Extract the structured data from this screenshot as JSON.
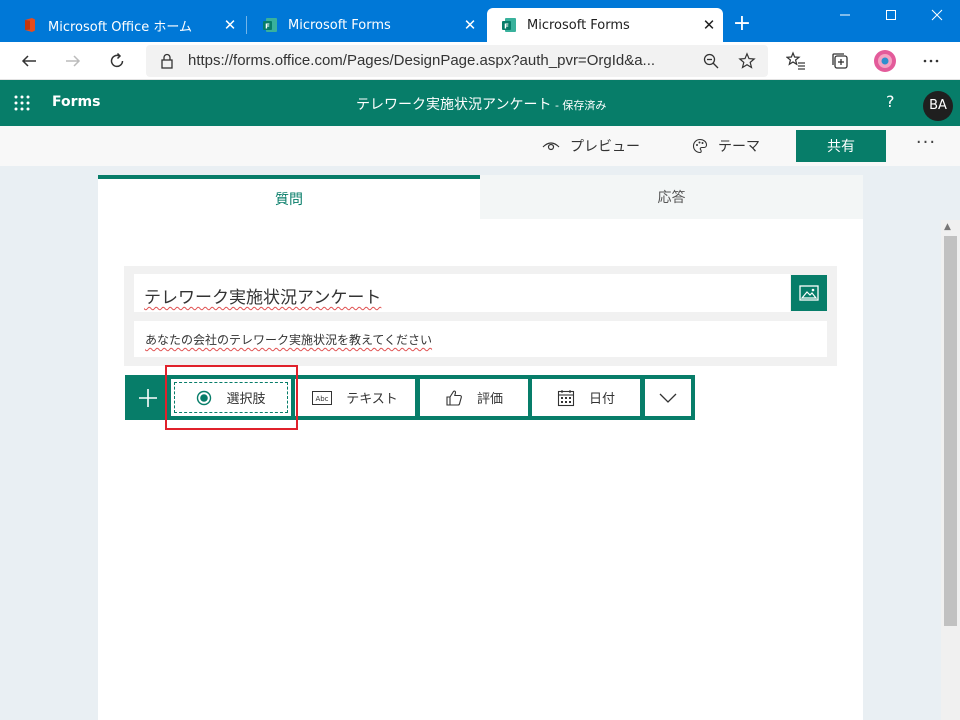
{
  "browser": {
    "tabs": [
      {
        "title": "Microsoft Office ホーム",
        "close": "✕"
      },
      {
        "title": "Microsoft Forms",
        "close": "✕"
      },
      {
        "title": "Microsoft Forms",
        "close": "✕"
      }
    ],
    "new_tab": "+",
    "url": "https://forms.office.com/Pages/DesignPage.aspx?auth_pvr=OrgId&a...",
    "window_controls": [
      "minimize-icon",
      "maximize-icon",
      "close-icon"
    ]
  },
  "app": {
    "name": "Forms",
    "doc_title": "テレワーク実施状況アンケート",
    "doc_status": " - 保存済み",
    "help": "?",
    "avatar": "BA",
    "brand_color": "#077d69"
  },
  "commands": {
    "preview": "プレビュー",
    "theme": "テーマ",
    "share": "共有",
    "more": "···"
  },
  "tabs": {
    "questions": "質問",
    "responses": "応答"
  },
  "form": {
    "title": "テレワーク実施状況アンケート",
    "description": "あなたの会社のテレワーク実施状況を教えてください"
  },
  "question_types": {
    "choice": "選択肢",
    "text": "テキスト",
    "rating": "評価",
    "date": "日付"
  }
}
